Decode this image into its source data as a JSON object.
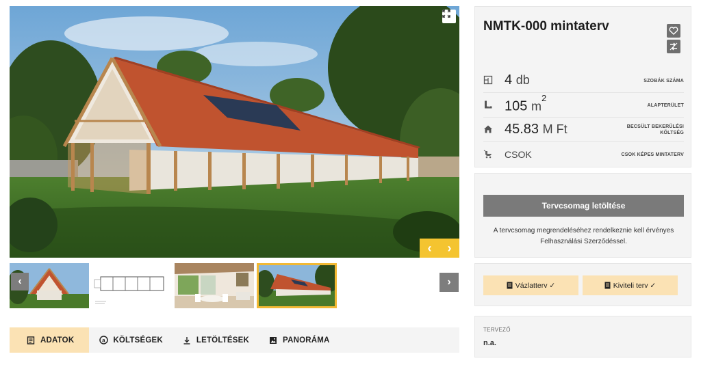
{
  "gallery": {
    "thumbnails": [
      {
        "name": "thumb-exterior-front",
        "active": false
      },
      {
        "name": "thumb-floorplan",
        "active": false
      },
      {
        "name": "thumb-interior",
        "active": false
      },
      {
        "name": "thumb-exterior-side",
        "active": true
      }
    ],
    "prev_icon": "chevron-left-icon",
    "next_icon": "chevron-right-icon",
    "expand_icon": "expand-icon"
  },
  "tabs": [
    {
      "label": "ADATOK",
      "icon": "document-icon",
      "active": true
    },
    {
      "label": "KÖLTSÉGEK",
      "icon": "cost-icon",
      "active": false
    },
    {
      "label": "LETÖLTÉSEK",
      "icon": "download-icon",
      "active": false
    },
    {
      "label": "PANORÁMA",
      "icon": "image-icon",
      "active": false
    }
  ],
  "plan": {
    "title": "NMTK-000 mintaterv",
    "stats": {
      "rooms": {
        "value": "4",
        "unit": "db",
        "label": "SZOBÁK SZÁMA",
        "icon": "floorplan-icon"
      },
      "area": {
        "value": "105",
        "unit": "m",
        "unit_sup": "2",
        "label": "ALAPTERÜLET",
        "icon": "ruler-icon"
      },
      "cost": {
        "value": "45.83",
        "unit": "M Ft",
        "label": "BECSÜLT BEKERÜLÉSI KÖLTSÉG",
        "icon": "house-icon"
      },
      "csok": {
        "value": "CSOK",
        "label": "CSOK KÉPES MINTATERV",
        "icon": "stroller-icon"
      }
    }
  },
  "download": {
    "button_label": "Tervcsomag letöltése",
    "note": "A tervcsomag megrendeléséhez rendelkeznie kell érvényes Felhasználási Szerződéssel."
  },
  "plan_types": {
    "sketch_label": "Vázlatterv ✓",
    "execution_label": "Kiviteli terv ✓"
  },
  "designer": {
    "label": "TERVEZŐ",
    "value": "n.a."
  },
  "colors": {
    "accent": "#f4c430",
    "tab_active": "#fbe2b4",
    "button_gray": "#7a7a7a",
    "roof": "#c0532f"
  }
}
